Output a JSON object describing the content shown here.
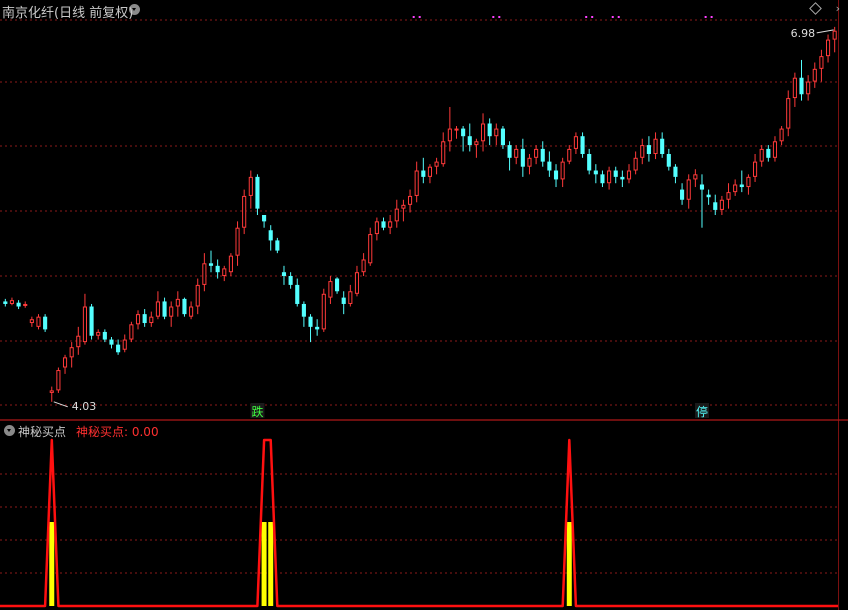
{
  "header": {
    "title": "南京化纤(日线 前复权)",
    "options_icon": "chevron-down-icon",
    "settings_icon": "diamond-icon",
    "expand_icon": "chevron-right-icon"
  },
  "indicator": {
    "name": "神秘买点",
    "value_text": "神秘买点: 0.00",
    "toggle_icon": "chevron-down-icon"
  },
  "colors": {
    "up": "#ff3a3a",
    "down": "#54ffff",
    "grid": "#8b1a1a",
    "indicator_line": "#ff1010",
    "indicator_bar": "#ffff00",
    "marker_dots": "#ff40ff",
    "label_die": "#40ff40",
    "label_ting": "#54ffff"
  },
  "chart_data": [
    {
      "type": "candlestick",
      "title": "南京化纤(日线 前复权)",
      "ylim": [
        3.95,
        7.05
      ],
      "annotations": {
        "high": {
          "label": "6.98",
          "value": 6.98
        },
        "low": {
          "label": "4.03",
          "value": 4.03
        },
        "markers": [
          {
            "text": "跌",
            "index": 38
          },
          {
            "text": "停",
            "index": 105
          }
        ],
        "top_dots": [
          {
            "index": 62
          },
          {
            "index": 74
          },
          {
            "index": 88
          },
          {
            "index": 92
          },
          {
            "index": 106
          }
        ]
      },
      "series": [
        {
          "name": "日线",
          "ohlc": [
            [
              4.82,
              4.84,
              4.78,
              4.8
            ],
            [
              4.8,
              4.85,
              4.79,
              4.83
            ],
            [
              4.81,
              4.83,
              4.76,
              4.78
            ],
            [
              4.79,
              4.82,
              4.77,
              4.8
            ],
            [
              4.65,
              4.7,
              4.62,
              4.68
            ],
            [
              4.62,
              4.72,
              4.6,
              4.7
            ],
            [
              4.7,
              4.72,
              4.58,
              4.6
            ],
            [
              4.1,
              4.15,
              4.03,
              4.12
            ],
            [
              4.12,
              4.3,
              4.1,
              4.28
            ],
            [
              4.3,
              4.4,
              4.25,
              4.38
            ],
            [
              4.38,
              4.5,
              4.3,
              4.46
            ],
            [
              4.46,
              4.62,
              4.4,
              4.55
            ],
            [
              4.5,
              4.88,
              4.48,
              4.78
            ],
            [
              4.78,
              4.8,
              4.52,
              4.55
            ],
            [
              4.55,
              4.6,
              4.52,
              4.58
            ],
            [
              4.58,
              4.6,
              4.5,
              4.52
            ],
            [
              4.52,
              4.54,
              4.45,
              4.48
            ],
            [
              4.48,
              4.52,
              4.4,
              4.42
            ],
            [
              4.44,
              4.56,
              4.42,
              4.52
            ],
            [
              4.52,
              4.66,
              4.5,
              4.64
            ],
            [
              4.64,
              4.75,
              4.6,
              4.72
            ],
            [
              4.72,
              4.76,
              4.62,
              4.65
            ],
            [
              4.65,
              4.74,
              4.62,
              4.7
            ],
            [
              4.7,
              4.9,
              4.68,
              4.82
            ],
            [
              4.82,
              4.85,
              4.68,
              4.7
            ],
            [
              4.7,
              4.82,
              4.62,
              4.78
            ],
            [
              4.78,
              4.9,
              4.7,
              4.84
            ],
            [
              4.84,
              4.85,
              4.7,
              4.72
            ],
            [
              4.7,
              4.82,
              4.68,
              4.78
            ],
            [
              4.78,
              5.0,
              4.72,
              4.95
            ],
            [
              4.95,
              5.2,
              4.9,
              5.12
            ],
            [
              5.12,
              5.22,
              5.05,
              5.1
            ],
            [
              5.1,
              5.15,
              5.0,
              5.05
            ],
            [
              5.02,
              5.1,
              4.98,
              5.08
            ],
            [
              5.05,
              5.2,
              5.02,
              5.18
            ],
            [
              5.18,
              5.45,
              5.1,
              5.4
            ],
            [
              5.4,
              5.7,
              5.35,
              5.65
            ],
            [
              5.65,
              5.85,
              5.55,
              5.8
            ],
            [
              5.8,
              5.82,
              5.5,
              5.55
            ],
            [
              5.5,
              5.5,
              5.4,
              5.45
            ],
            [
              5.38,
              5.42,
              5.22,
              5.3
            ],
            [
              5.3,
              5.32,
              5.2,
              5.22
            ],
            [
              5.05,
              5.1,
              4.95,
              5.02
            ],
            [
              5.02,
              5.05,
              4.92,
              4.95
            ],
            [
              4.95,
              5.0,
              4.78,
              4.8
            ],
            [
              4.8,
              4.82,
              4.62,
              4.7
            ],
            [
              4.7,
              4.72,
              4.5,
              4.62
            ],
            [
              4.62,
              4.68,
              4.55,
              4.6
            ],
            [
              4.6,
              4.92,
              4.58,
              4.88
            ],
            [
              4.85,
              5.02,
              4.8,
              4.98
            ],
            [
              5.0,
              5.01,
              4.88,
              4.9
            ],
            [
              4.85,
              4.9,
              4.72,
              4.8
            ],
            [
              4.8,
              4.95,
              4.78,
              4.9
            ],
            [
              4.88,
              5.1,
              4.86,
              5.05
            ],
            [
              5.05,
              5.2,
              5.02,
              5.15
            ],
            [
              5.12,
              5.4,
              5.1,
              5.35
            ],
            [
              5.35,
              5.48,
              5.3,
              5.45
            ],
            [
              5.45,
              5.48,
              5.38,
              5.4
            ],
            [
              5.4,
              5.5,
              5.35,
              5.45
            ],
            [
              5.45,
              5.62,
              5.4,
              5.55
            ],
            [
              5.55,
              5.62,
              5.45,
              5.58
            ],
            [
              5.58,
              5.7,
              5.52,
              5.65
            ],
            [
              5.65,
              5.92,
              5.6,
              5.85
            ],
            [
              5.85,
              5.95,
              5.75,
              5.8
            ],
            [
              5.8,
              5.9,
              5.75,
              5.88
            ],
            [
              5.88,
              5.95,
              5.82,
              5.92
            ],
            [
              5.9,
              6.15,
              5.88,
              6.08
            ],
            [
              6.08,
              6.35,
              6.0,
              6.18
            ],
            [
              6.18,
              6.2,
              6.1,
              6.18
            ],
            [
              6.18,
              6.2,
              6.0,
              6.12
            ],
            [
              6.12,
              6.22,
              6.0,
              6.05
            ],
            [
              6.05,
              6.1,
              5.95,
              6.08
            ],
            [
              6.08,
              6.3,
              6.0,
              6.22
            ],
            [
              6.22,
              6.26,
              6.05,
              6.12
            ],
            [
              6.12,
              6.22,
              6.05,
              6.18
            ],
            [
              6.18,
              6.2,
              6.02,
              6.05
            ],
            [
              6.05,
              6.08,
              5.85,
              5.95
            ],
            [
              5.95,
              6.05,
              5.9,
              6.02
            ],
            [
              6.02,
              6.1,
              5.8,
              5.88
            ],
            [
              5.88,
              5.98,
              5.82,
              5.95
            ],
            [
              5.95,
              6.05,
              5.9,
              6.02
            ],
            [
              6.02,
              6.08,
              5.88,
              5.92
            ],
            [
              5.92,
              6.0,
              5.8,
              5.85
            ],
            [
              5.85,
              5.9,
              5.72,
              5.78
            ],
            [
              5.78,
              5.95,
              5.72,
              5.92
            ],
            [
              5.92,
              6.05,
              5.9,
              6.02
            ],
            [
              6.02,
              6.15,
              5.98,
              6.12
            ],
            [
              6.12,
              6.15,
              5.95,
              5.98
            ],
            [
              5.98,
              6.02,
              5.82,
              5.85
            ],
            [
              5.85,
              5.9,
              5.75,
              5.82
            ],
            [
              5.82,
              5.85,
              5.72,
              5.75
            ],
            [
              5.75,
              5.88,
              5.7,
              5.85
            ],
            [
              5.85,
              5.88,
              5.75,
              5.8
            ],
            [
              5.8,
              5.85,
              5.72,
              5.78
            ],
            [
              5.78,
              5.9,
              5.75,
              5.85
            ],
            [
              5.85,
              6.0,
              5.82,
              5.95
            ],
            [
              5.95,
              6.1,
              5.9,
              6.05
            ],
            [
              6.05,
              6.12,
              5.92,
              5.98
            ],
            [
              5.98,
              6.15,
              5.94,
              6.1
            ],
            [
              6.1,
              6.15,
              5.95,
              5.98
            ],
            [
              5.98,
              6.02,
              5.85,
              5.88
            ],
            [
              5.88,
              5.9,
              5.75,
              5.8
            ],
            [
              5.7,
              5.75,
              5.58,
              5.62
            ],
            [
              5.62,
              5.82,
              5.55,
              5.78
            ],
            [
              5.78,
              5.86,
              5.72,
              5.82
            ],
            [
              5.74,
              5.82,
              5.4,
              5.7
            ],
            [
              5.66,
              5.7,
              5.58,
              5.64
            ],
            [
              5.6,
              5.66,
              5.5,
              5.54
            ],
            [
              5.54,
              5.65,
              5.5,
              5.62
            ],
            [
              5.62,
              5.75,
              5.55,
              5.68
            ],
            [
              5.68,
              5.78,
              5.65,
              5.74
            ],
            [
              5.74,
              5.85,
              5.68,
              5.72
            ],
            [
              5.72,
              5.82,
              5.66,
              5.8
            ],
            [
              5.8,
              5.98,
              5.76,
              5.92
            ],
            [
              5.92,
              6.05,
              5.88,
              6.02
            ],
            [
              6.02,
              6.05,
              5.92,
              5.95
            ],
            [
              5.95,
              6.12,
              5.92,
              6.08
            ],
            [
              6.08,
              6.2,
              6.05,
              6.18
            ],
            [
              6.18,
              6.48,
              6.12,
              6.42
            ],
            [
              6.42,
              6.62,
              6.35,
              6.58
            ],
            [
              6.58,
              6.72,
              6.4,
              6.45
            ],
            [
              6.45,
              6.6,
              6.4,
              6.55
            ],
            [
              6.55,
              6.7,
              6.5,
              6.65
            ],
            [
              6.65,
              6.8,
              6.55,
              6.75
            ],
            [
              6.75,
              6.92,
              6.7,
              6.88
            ],
            [
              6.88,
              6.98,
              6.78,
              6.95
            ]
          ]
        }
      ]
    },
    {
      "type": "area",
      "title": "神秘买点",
      "ylim": [
        0,
        1
      ],
      "series": [
        {
          "name": "神秘买点",
          "spikes": [
            {
              "index": 7,
              "value": 1
            },
            {
              "index": 39,
              "value": 1
            },
            {
              "index": 40,
              "value": 1
            },
            {
              "index": 85,
              "value": 1
            }
          ],
          "last": 0.0
        }
      ]
    }
  ]
}
